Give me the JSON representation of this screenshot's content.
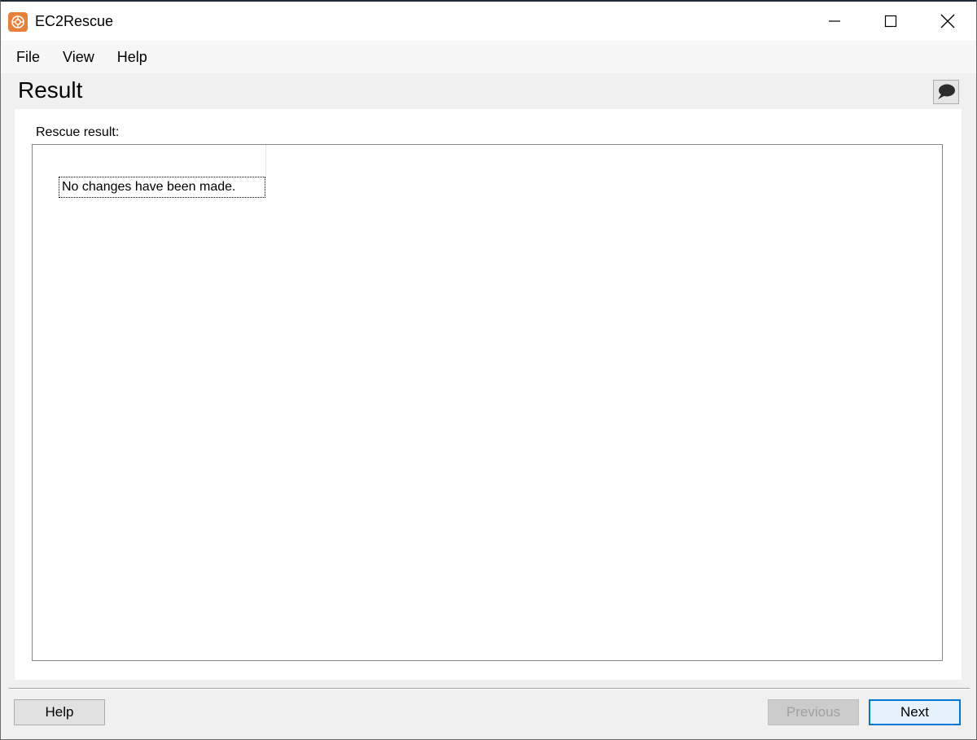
{
  "window": {
    "title": "EC2Rescue",
    "app_icon": "ec2rescue-lifebuoy-icon",
    "controls": [
      "minimize-icon",
      "maximize-icon",
      "close-icon"
    ]
  },
  "menu": {
    "items": [
      "File",
      "View",
      "Help"
    ]
  },
  "header": {
    "title": "Result",
    "feedback_icon": "speech-bubble-icon"
  },
  "content": {
    "label": "Rescue result:",
    "results": [
      "No changes have been made."
    ]
  },
  "footer": {
    "help_label": "Help",
    "previous_label": "Previous",
    "previous_enabled": false,
    "next_label": "Next"
  },
  "colors": {
    "accent": "#0078d7",
    "app_icon": "#e8803b",
    "background": "#f0f0f0"
  }
}
